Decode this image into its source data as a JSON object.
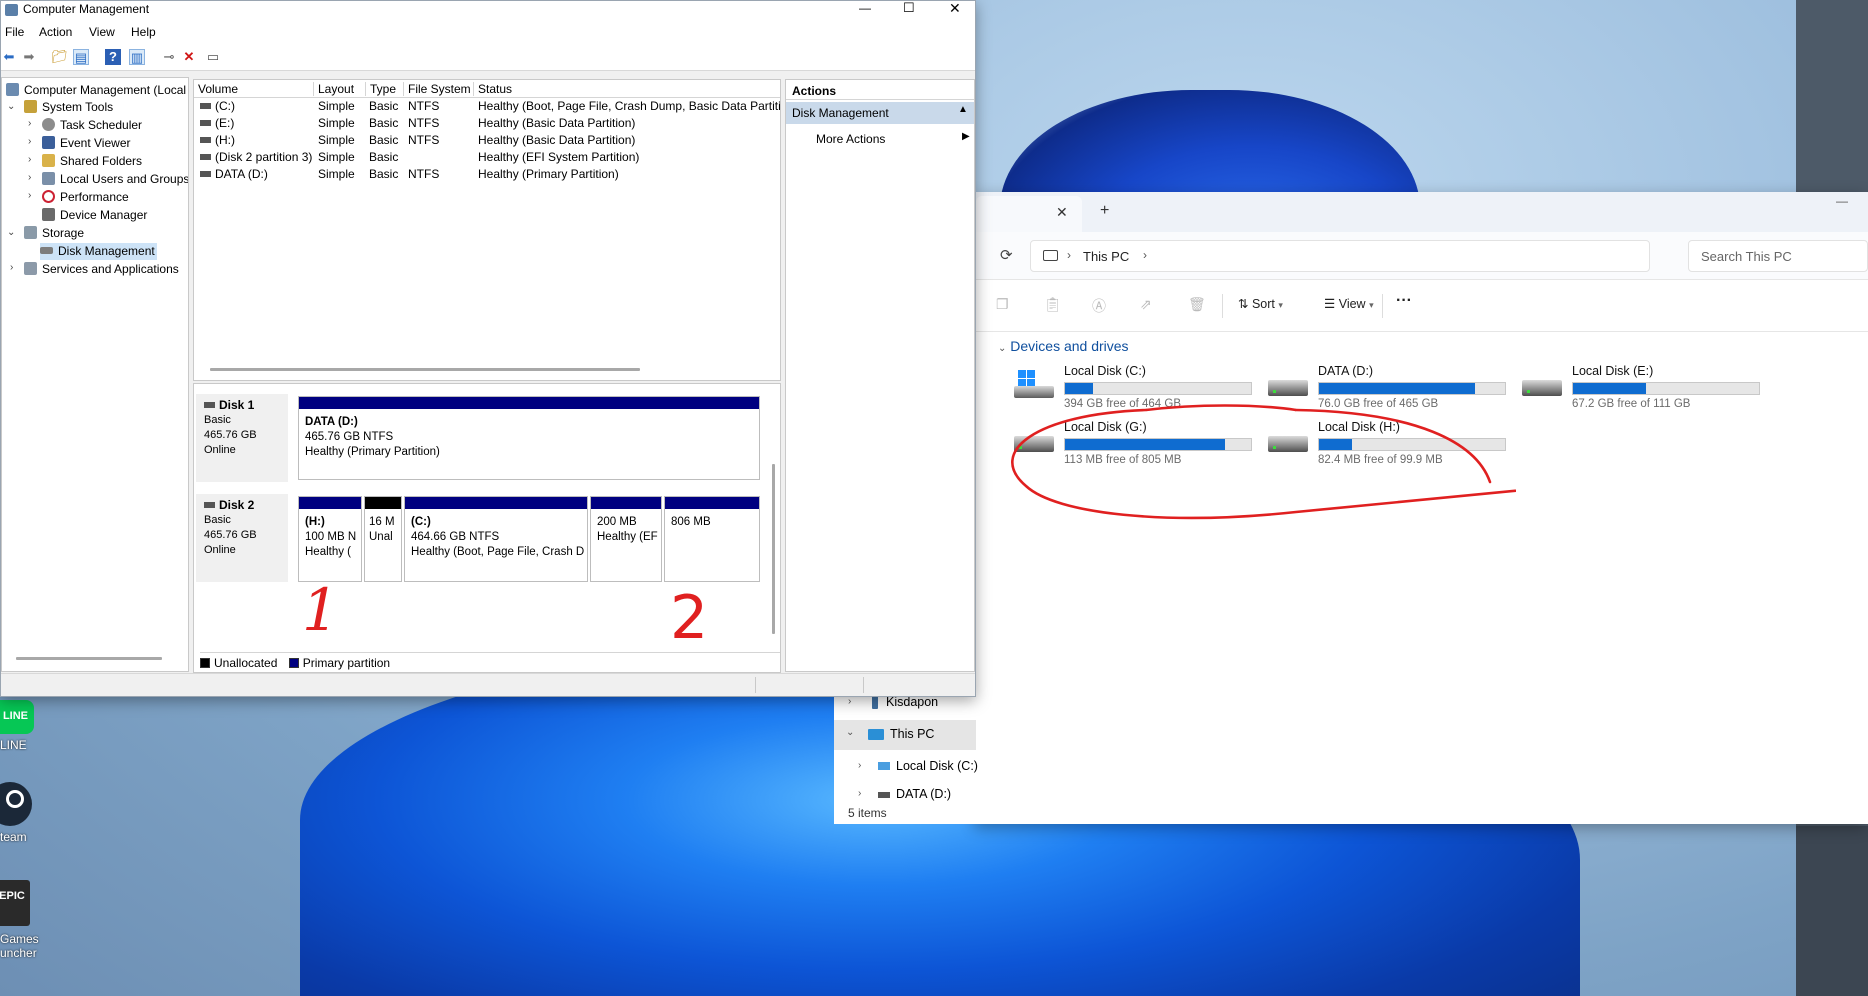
{
  "computer_management": {
    "title": "Computer Management",
    "window_buttons": {
      "minimize": "—",
      "maximize": "☐",
      "close": "✕"
    },
    "menu": [
      "File",
      "Action",
      "View",
      "Help"
    ],
    "tree": [
      {
        "label": "Computer Management (Local",
        "level": 0
      },
      {
        "label": "System Tools",
        "level": 1,
        "expanded": true
      },
      {
        "label": "Task Scheduler",
        "level": 2
      },
      {
        "label": "Event Viewer",
        "level": 2
      },
      {
        "label": "Shared Folders",
        "level": 2
      },
      {
        "label": "Local Users and Groups",
        "level": 2
      },
      {
        "label": "Performance",
        "level": 2
      },
      {
        "label": "Device Manager",
        "level": 2
      },
      {
        "label": "Storage",
        "level": 1,
        "expanded": true
      },
      {
        "label": "Disk Management",
        "level": 2,
        "selected": true
      },
      {
        "label": "Services and Applications",
        "level": 1
      }
    ],
    "volume_table": {
      "columns": [
        "Volume",
        "Layout",
        "Type",
        "File System",
        "Status"
      ],
      "rows": [
        [
          "(C:)",
          "Simple",
          "Basic",
          "NTFS",
          "Healthy (Boot, Page File, Crash Dump, Basic Data Partition"
        ],
        [
          "(E:)",
          "Simple",
          "Basic",
          "NTFS",
          "Healthy (Basic Data Partition)"
        ],
        [
          "(H:)",
          "Simple",
          "Basic",
          "NTFS",
          "Healthy (Basic Data Partition)"
        ],
        [
          "(Disk 2 partition 3)",
          "Simple",
          "Basic",
          "",
          "Healthy (EFI System Partition)"
        ],
        [
          "DATA (D:)",
          "Simple",
          "Basic",
          "NTFS",
          "Healthy (Primary Partition)"
        ]
      ]
    },
    "disks": [
      {
        "name": "Disk 1",
        "type": "Basic",
        "size": "465.76 GB",
        "state": "Online",
        "partitions": [
          {
            "line1": "DATA  (D:)",
            "line2": "465.76 GB NTFS",
            "line3": "Healthy (Primary Partition)",
            "bar": "primary"
          }
        ]
      },
      {
        "name": "Disk 2",
        "type": "Basic",
        "size": "465.76 GB",
        "state": "Online",
        "partitions": [
          {
            "line1": "(H:)",
            "line2": "100 MB N",
            "line3": "Healthy (",
            "bar": "primary"
          },
          {
            "line1": "",
            "line2": "16 M",
            "line3": "Unal",
            "bar": "unallocated"
          },
          {
            "line1": "(C:)",
            "line2": "464.66 GB NTFS",
            "line3": "Healthy (Boot, Page File, Crash D",
            "bar": "primary"
          },
          {
            "line1": "",
            "line2": "200 MB",
            "line3": "Healthy (EF",
            "bar": "primary"
          },
          {
            "line1": "",
            "line2": "806 MB",
            "line3": "",
            "bar": "primary"
          }
        ]
      }
    ],
    "legend": [
      "Unallocated",
      "Primary partition"
    ],
    "annotations": [
      "1",
      "2"
    ],
    "actions": {
      "header": "Actions",
      "section": "Disk Management",
      "item": "More Actions"
    },
    "colors": {
      "primary": "#000080",
      "unallocated": "#000000",
      "selection": "#cde3f7"
    }
  },
  "explorer": {
    "tab_close": "✕",
    "tab_add": "+",
    "breadcrumb": "This PC",
    "search_placeholder": "Search This PC",
    "toolbar": {
      "sort": "Sort",
      "view": "View",
      "more": "···"
    },
    "section": "Devices and drives",
    "drives": [
      {
        "name": "Local Disk (C:)",
        "free": "394 GB free of 464 GB",
        "used_fraction": 0.15,
        "windows": true
      },
      {
        "name": "DATA (D:)",
        "free": "76.0 GB free of 465 GB",
        "used_fraction": 0.84
      },
      {
        "name": "Local Disk (E:)",
        "free": "67.2 GB free of 111 GB",
        "used_fraction": 0.39
      },
      {
        "name": "Local Disk (G:)",
        "free": "113 MB free of 805 MB",
        "used_fraction": 0.86
      },
      {
        "name": "Local Disk (H:)",
        "free": "82.4 MB free of 99.9 MB",
        "used_fraction": 0.18
      }
    ],
    "nav": [
      {
        "label": "Kisdapon"
      },
      {
        "label": "This PC",
        "selected": true
      },
      {
        "label": "Local Disk (C:)"
      },
      {
        "label": "DATA (D:)"
      }
    ],
    "status": "5 items",
    "accent": "#0f6cd0"
  },
  "desktop_icons": [
    {
      "label": "LINE",
      "badge": "LINE"
    },
    {
      "label": "team",
      "badge": ""
    },
    {
      "label": "Games",
      "label2": "uncher",
      "badge": "EPIC"
    }
  ]
}
